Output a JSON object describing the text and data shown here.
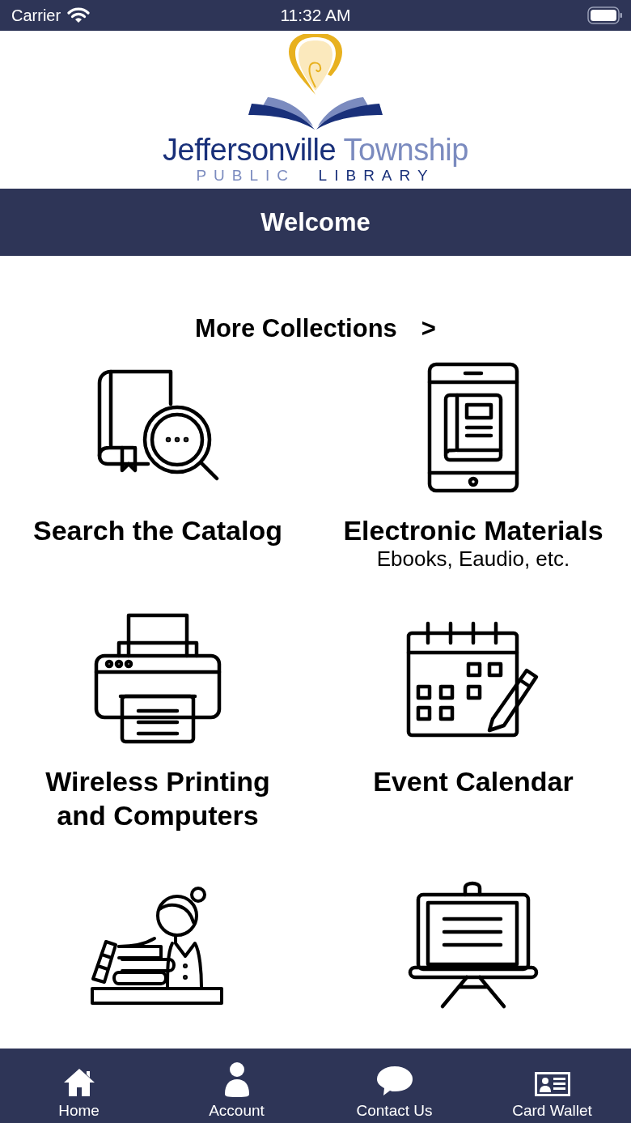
{
  "status_bar": {
    "carrier": "Carrier",
    "time": "11:32 AM"
  },
  "logo": {
    "name_first": "Jeffersonville",
    "name_second": "Township",
    "sub_first": "PUBLIC",
    "sub_second": "LIBRARY"
  },
  "header": {
    "title": "Welcome"
  },
  "more_link": {
    "label": "More Collections",
    "arrow": ">"
  },
  "tiles": [
    {
      "title": "Search the Catalog"
    },
    {
      "title": "Electronic Materials",
      "subtitle": "Ebooks, Eaudio, etc."
    },
    {
      "title": "Wireless Printing and Computers"
    },
    {
      "title": "Event Calendar"
    }
  ],
  "tab_bar": [
    {
      "label": "Home"
    },
    {
      "label": "Account"
    },
    {
      "label": "Contact Us"
    },
    {
      "label": "Card Wallet"
    }
  ]
}
